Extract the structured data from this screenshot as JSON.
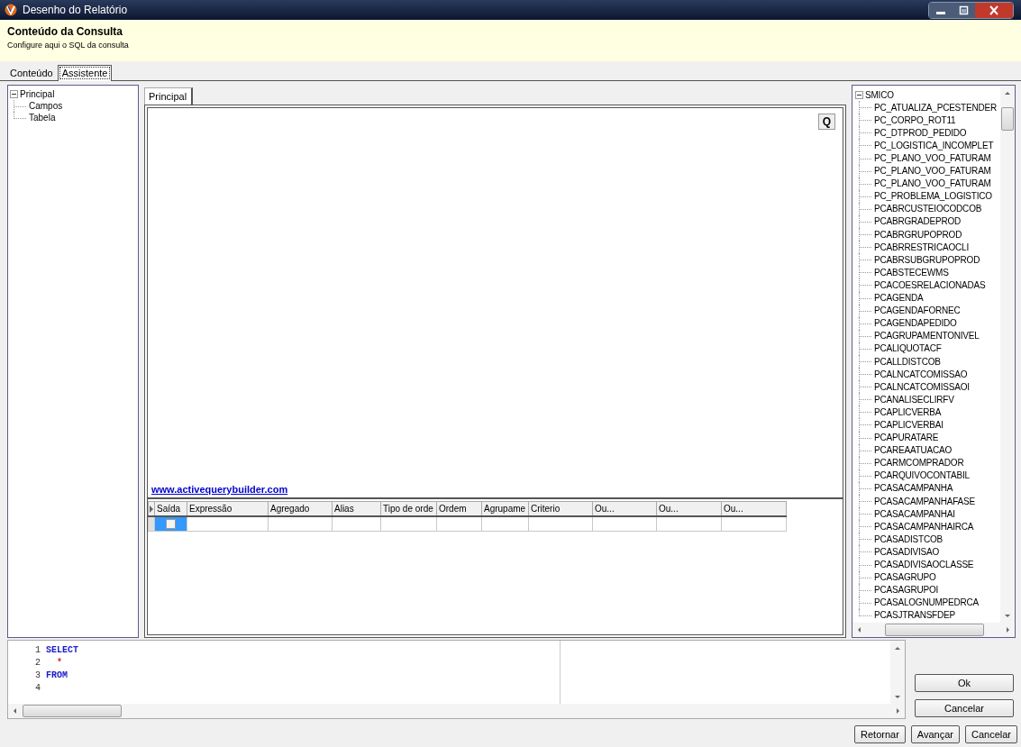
{
  "window": {
    "title": "Desenho do Relatório"
  },
  "header": {
    "title": "Conteúdo da Consulta",
    "subtitle": "Configure aqui o SQL da consulta"
  },
  "tabs": [
    {
      "label": "Conteúdo",
      "selected": false
    },
    {
      "label": "Assistente",
      "selected": true
    }
  ],
  "left_tree": {
    "items": [
      {
        "label": "Principal",
        "expanded": true,
        "children": [
          {
            "label": "Campos"
          },
          {
            "label": "Tabela"
          }
        ]
      }
    ]
  },
  "designer_tabs": [
    {
      "label": "Principal",
      "selected": true
    }
  ],
  "canvas": {
    "button": "Q",
    "link": "www.activequerybuilder.com"
  },
  "grid": {
    "columns": [
      "Saída",
      "Expressão",
      "Agregado",
      "Alias",
      "Tipo de orde",
      "Ordem",
      "Agrupame",
      "Criterio",
      "Ou...",
      "Ou...",
      "Ou..."
    ],
    "rows": [
      {
        "selected": true,
        "checked": false
      }
    ]
  },
  "right_tree": {
    "items": [
      {
        "label": "SMICO",
        "expanded": true,
        "children": [
          {
            "label": "PC_ATUALIZA_PCESTENDER"
          },
          {
            "label": "PC_CORPO_ROT11"
          },
          {
            "label": "PC_DTPROD_PEDIDO"
          },
          {
            "label": "PC_LOGISTICA_INCOMPLET"
          },
          {
            "label": "PC_PLANO_VOO_FATURAM"
          },
          {
            "label": "PC_PLANO_VOO_FATURAM"
          },
          {
            "label": "PC_PLANO_VOO_FATURAM"
          },
          {
            "label": "PC_PROBLEMA_LOGISTICO"
          },
          {
            "label": "PCABRCUSTEIOCODCOB"
          },
          {
            "label": "PCABRGRADEPROD"
          },
          {
            "label": "PCABRGRUPOPROD"
          },
          {
            "label": "PCABRRESTRICAOCLI"
          },
          {
            "label": "PCABRSUBGRUPOPROD"
          },
          {
            "label": "PCABSTECEWMS"
          },
          {
            "label": "PCACOESRELACIONADAS"
          },
          {
            "label": "PCAGENDA"
          },
          {
            "label": "PCAGENDAFORNEC"
          },
          {
            "label": "PCAGENDAPEDIDO"
          },
          {
            "label": "PCAGRUPAMENTONIVEL"
          },
          {
            "label": "PCALIQUOTACF"
          },
          {
            "label": "PCALLDISTCOB"
          },
          {
            "label": "PCALNCATCOMISSAO"
          },
          {
            "label": "PCALNCATCOMISSAOI"
          },
          {
            "label": "PCANALISECLIRFV"
          },
          {
            "label": "PCAPLICVERBA"
          },
          {
            "label": "PCAPLICVERBAI"
          },
          {
            "label": "PCAPURATARE"
          },
          {
            "label": "PCAREAATUACAO"
          },
          {
            "label": "PCARMCOMPRADOR"
          },
          {
            "label": "PCARQUIVOCONTABIL"
          },
          {
            "label": "PCASACAMPANHA"
          },
          {
            "label": "PCASACAMPANHAFASE"
          },
          {
            "label": "PCASACAMPANHAI"
          },
          {
            "label": "PCASACAMPANHAIRCA"
          },
          {
            "label": "PCASADISTCOB"
          },
          {
            "label": "PCASADIVISAO"
          },
          {
            "label": "PCASADIVISAOCLASSE"
          },
          {
            "label": "PCASAGRUPO"
          },
          {
            "label": "PCASAGRUPOI"
          },
          {
            "label": "PCASALOGNUMPEDRCA"
          },
          {
            "label": "PCASJTRANSFDEP"
          }
        ]
      }
    ]
  },
  "sql": {
    "lines": [
      {
        "number": "1",
        "tokens": [
          {
            "text": "SELECT",
            "kind": "keyword"
          }
        ]
      },
      {
        "number": "2",
        "tokens": [
          {
            "text": "  *",
            "kind": "symbol"
          }
        ]
      },
      {
        "number": "3",
        "tokens": [
          {
            "text": "FROM",
            "kind": "keyword"
          }
        ]
      },
      {
        "number": "4"
      }
    ]
  },
  "dialog_buttons": [
    "Ok",
    "Cancelar"
  ],
  "wizard_buttons": [
    "Retornar",
    "Avançar",
    "Cancelar"
  ]
}
